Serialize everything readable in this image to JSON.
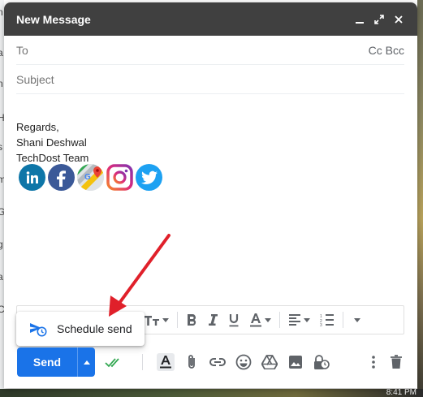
{
  "window": {
    "title": "New Message"
  },
  "fields": {
    "to_label": "To",
    "ccbcc_label": "Cc Bcc",
    "subject_placeholder": "Subject"
  },
  "signature": {
    "line1": "Regards,",
    "line2": "Shani Deshwal",
    "line3": "TechDost Team"
  },
  "social_icons": [
    "linkedin-icon",
    "facebook-icon",
    "google-maps-icon",
    "instagram-icon",
    "twitter-icon"
  ],
  "popup": {
    "label": "Schedule send"
  },
  "bottom": {
    "send_label": "Send"
  },
  "taskbar": {
    "time": "8:41 PM"
  },
  "background_fragments": [
    "n",
    "a",
    "n",
    "H",
    "s",
    "m",
    "G",
    "g",
    "a",
    "C"
  ],
  "colors": {
    "accent": "#1a73e8",
    "titlebar": "#404040",
    "arrow": "#e0202a"
  }
}
